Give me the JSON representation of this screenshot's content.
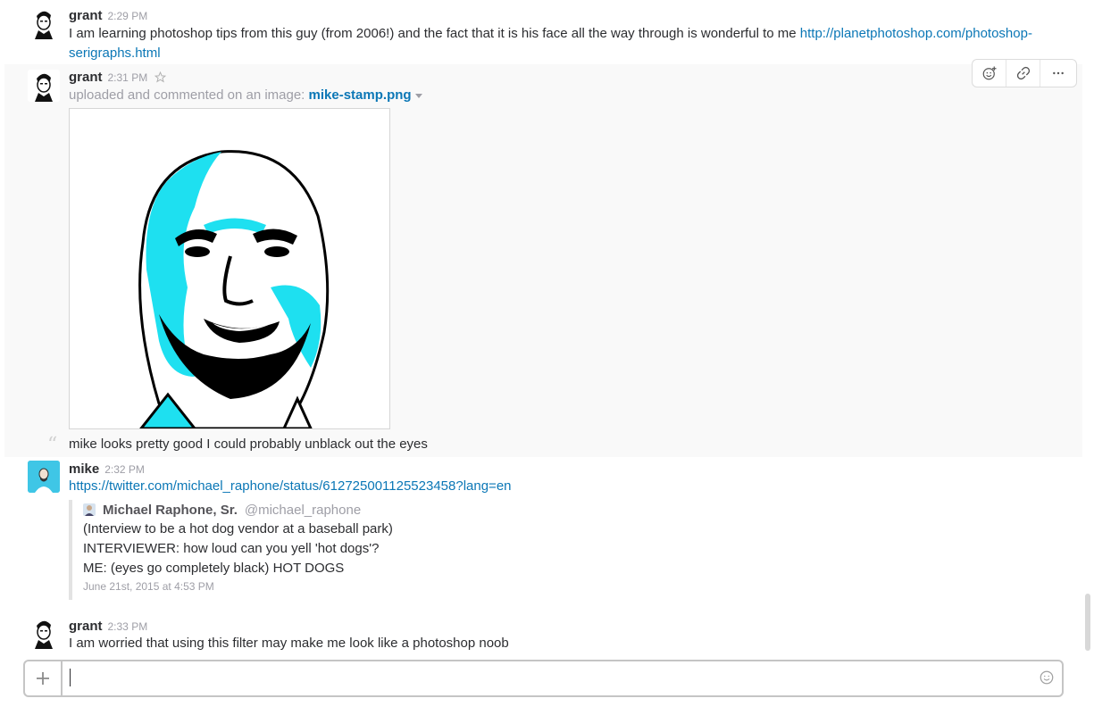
{
  "messages": [
    {
      "author": "grant",
      "time": "2:29 PM",
      "text": "I am learning photoshop tips from this guy (from 2006!) and the fact that it is his face all the way through is wonderful to me ",
      "link_line1": "http://planetphotoshop.com/photoshop-",
      "link_line2": "serigraphs.html"
    },
    {
      "author": "grant",
      "time": "2:31 PM",
      "upload_prefix": "uploaded and commented on an image:",
      "file_name": "mike-stamp.png",
      "comment": "mike looks pretty good I could probably unblack out the eyes"
    },
    {
      "author": "mike",
      "time": "2:32 PM",
      "link": "https://twitter.com/michael_raphone/status/612725001125523458?lang=en",
      "tweet": {
        "name": "Michael Raphone, Sr.",
        "handle": "@michael_raphone",
        "lines": [
          "(Interview to be a hot dog vendor at a baseball park)",
          "INTERVIEWER: how loud can you yell 'hot dogs'?",
          "ME: (eyes go completely black) HOT DOGS"
        ],
        "date": "June 21st, 2015 at 4:53 PM"
      }
    },
    {
      "author": "grant",
      "time": "2:33 PM",
      "text": "I am worried that using this filter may make me look like a photoshop noob"
    }
  ],
  "composer": {
    "value": "",
    "placeholder": ""
  },
  "icons": {
    "star": "star-icon",
    "reaction": "add-reaction-icon",
    "link": "link-icon",
    "more": "more-actions-icon",
    "quote": "quote-icon",
    "dropdown": "caret-down-icon",
    "plus": "plus-icon",
    "emoji": "emoji-icon"
  },
  "colors": {
    "link": "#0b77b6",
    "stamp_cyan": "#1ee0f0",
    "hover_bg": "#f9f9f9"
  }
}
